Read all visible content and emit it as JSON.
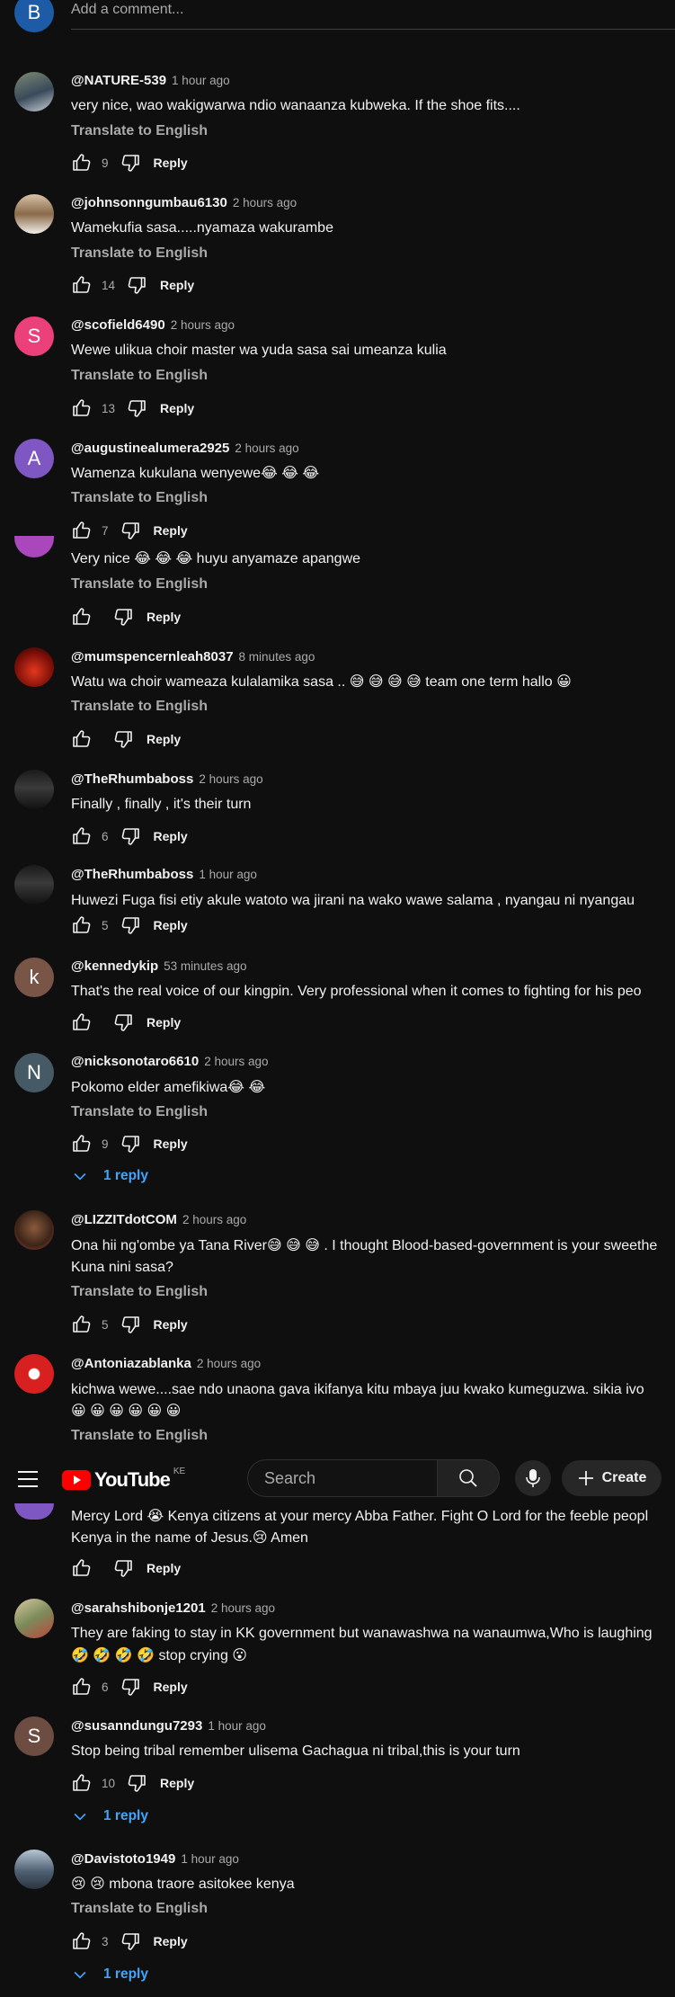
{
  "composer": {
    "avatar_letter": "B",
    "placeholder": "Add a comment..."
  },
  "header": {
    "logo_text": "YouTube",
    "region": "KE",
    "search_placeholder": "Search",
    "create_label": "Create"
  },
  "labels": {
    "translate": "Translate to English",
    "reply": "Reply"
  },
  "comments": [
    {
      "handle": "@NATURE-539",
      "time": "1 hour ago",
      "text": [
        "very nice,  wao wakigwarwa ndio wanaanza kubweka. If the shoe fits...."
      ],
      "likes": "9"
    },
    {
      "handle": "@johnsonngumbau6130",
      "time": "2 hours ago",
      "text": [
        "Wamekufia sasa.....nyamaza wakurambe"
      ],
      "likes": "14"
    },
    {
      "avatar_letter": "S",
      "handle": "@scofield6490",
      "time": "2 hours ago",
      "text": [
        "Wewe ulikua choir master wa yuda sasa sai umeanza kulia"
      ],
      "likes": "13"
    },
    {
      "avatar_letter": "A",
      "handle": "@augustinealumera2925",
      "time": "2 hours ago",
      "text": [
        "Wamenza kukulana wenyewe😂 😂 😂"
      ],
      "likes": "7"
    },
    {
      "text": [
        "Very nice 😂 😂 😂 huyu anyamaze apangwe"
      ],
      "likes": ""
    },
    {
      "handle": "@mumspencernleah8037",
      "time": "8 minutes ago",
      "text": [
        "Watu wa choir wameaza kulalamika sasa .. 😅 😅 😅 😅 team one term hallo 😀"
      ],
      "likes": ""
    },
    {
      "handle": "@TheRhumbaboss",
      "time": "2 hours ago",
      "text": [
        "Finally , finally  , it's their turn"
      ],
      "likes": "6"
    },
    {
      "handle": "@TheRhumbaboss",
      "time": "1 hour ago",
      "text": [
        "Huwezi Fuga fisi etiy  akule watoto wa jirani na wako   wawe  salama , nyangau ni nyangau"
      ],
      "likes": "5"
    },
    {
      "avatar_letter": "k",
      "handle": "@kennedykip",
      "time": "53 minutes ago",
      "text": [
        "That's the real voice of our kingpin. Very professional when it comes to fighting for his peo"
      ],
      "likes": ""
    },
    {
      "avatar_letter": "N",
      "handle": "@nicksonotaro6610",
      "time": "2 hours ago",
      "text": [
        "Pokomo elder amefikiwa😂 😂"
      ],
      "likes": "9",
      "replies": "1 reply"
    },
    {
      "handle": "@LIZZITdotCOM",
      "time": "2 hours ago",
      "text": [
        "Ona hii ng'ombe ya Tana River😅 😅 😅 . I thought Blood-based-government is your sweethe",
        "Kuna nini sasa?"
      ],
      "likes": "5"
    },
    {
      "handle": "@Antoniazablanka",
      "time": "2 hours ago",
      "text": [
        "kichwa wewe....sae ndo unaona gava ikifanya kitu mbaya juu kwako kumeguzwa. sikia ivo",
        "😀 😀 😀 😀 😀 😀"
      ],
      "likes": ""
    },
    {
      "text": [
        "Mercy Lord 😭 Kenya citizens at your mercy Abba Father. Fight O Lord for the feeble peopl",
        "Kenya in the name of Jesus.😢 Amen"
      ],
      "likes": ""
    },
    {
      "handle": "@sarahshibonje1201",
      "time": "2 hours ago",
      "text": [
        "They are faking to stay in KK government but wanawashwa na wanaumwa,Who is laughing",
        "🤣 🤣 🤣 🤣 stop crying 😮"
      ],
      "likes": "6"
    },
    {
      "avatar_letter": "S",
      "handle": "@susanndungu7293",
      "time": "1 hour ago",
      "text": [
        "Stop being tribal remember ulisema Gachagua ni tribal,this is your turn"
      ],
      "likes": "10",
      "replies": "1 reply"
    },
    {
      "handle": "@Davistoto1949",
      "time": "1 hour ago",
      "text": [
        "😢 😢  mbona traore asitokee kenya"
      ],
      "likes": "3",
      "replies": "1 reply"
    }
  ]
}
